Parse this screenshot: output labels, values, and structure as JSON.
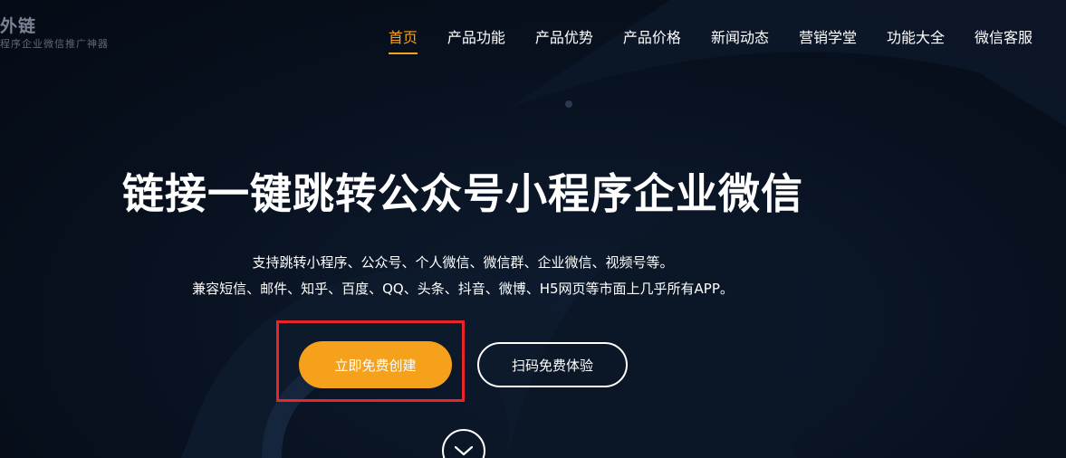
{
  "header": {
    "logo_title": "外链",
    "logo_subtitle": "程序企业微信推广神器",
    "nav": [
      {
        "label": "首页",
        "active": true
      },
      {
        "label": "产品功能",
        "active": false
      },
      {
        "label": "产品优势",
        "active": false
      },
      {
        "label": "产品价格",
        "active": false
      },
      {
        "label": "新闻动态",
        "active": false
      },
      {
        "label": "营销学堂",
        "active": false
      },
      {
        "label": "功能大全",
        "active": false
      },
      {
        "label": "微信客服",
        "active": false
      }
    ]
  },
  "hero": {
    "title": "链接一键跳转公众号小程序企业微信",
    "desc_line1": "支持跳转小程序、公众号、个人微信、微信群、企业微信、视频号等。",
    "desc_line2": "兼容短信、邮件、知乎、百度、QQ、头条、抖音、微博、H5网页等市面上几乎所有APP。",
    "primary_button": "立即免费创建",
    "secondary_button": "扫码免费体验",
    "scroll_icon": "chevron-down-icon"
  },
  "colors": {
    "accent": "#f5a11c",
    "highlight_border": "#e8262a",
    "background": "#070f1c",
    "text": "#ffffff"
  }
}
